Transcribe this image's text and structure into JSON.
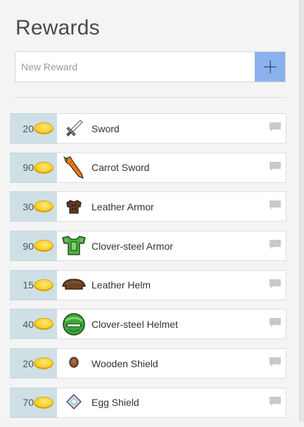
{
  "title": "Rewards",
  "new_reward": {
    "placeholder": "New Reward",
    "add_icon": "plus-icon"
  },
  "rewards": [
    {
      "price": "20",
      "name": "Sword",
      "icon": "sword-icon"
    },
    {
      "price": "90",
      "name": "Carrot Sword",
      "icon": "carrot-sword-icon"
    },
    {
      "price": "30",
      "name": "Leather Armor",
      "icon": "leather-armor-icon"
    },
    {
      "price": "90",
      "name": "Clover-steel Armor",
      "icon": "clover-steel-armor-icon"
    },
    {
      "price": "15",
      "name": "Leather Helm",
      "icon": "leather-helm-icon"
    },
    {
      "price": "40",
      "name": "Clover-steel Helmet",
      "icon": "clover-steel-helmet-icon"
    },
    {
      "price": "20",
      "name": "Wooden Shield",
      "icon": "wooden-shield-icon"
    },
    {
      "price": "70",
      "name": "Egg Shield",
      "icon": "egg-shield-icon"
    }
  ],
  "colors": {
    "add_button": "#8ab1ec",
    "price_cell": "#cfdfe6",
    "coin": "#f7cf2a"
  }
}
